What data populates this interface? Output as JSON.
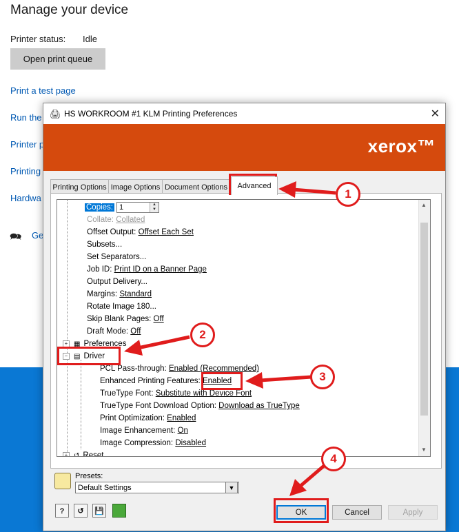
{
  "settings": {
    "title": "Manage your device",
    "printer_status_label": "Printer status:",
    "printer_status_value": "Idle",
    "open_queue_button": "Open print queue",
    "links": [
      "Print a test page",
      "Run the",
      "Printer p",
      "Printing",
      "Hardwa",
      "Ge"
    ]
  },
  "dialog": {
    "title": "HS WORKROOM #1 KLM Printing Preferences",
    "brand": "xerox™",
    "tabs": [
      "Printing Options",
      "Image Options",
      "Document Options",
      "Advanced"
    ],
    "active_tab": "Advanced"
  },
  "tree": {
    "copies_label": "Copies:",
    "copies_value": "1",
    "collate_label": "Collate:",
    "collate_value": "Collated",
    "offset_label": "Offset Output:",
    "offset_value": "Offset Each Set",
    "subsets": "Subsets...",
    "set_separators": "Set Separators...",
    "jobid_label": "Job ID:",
    "jobid_value": "Print ID on a Banner Page",
    "output_delivery": "Output Delivery...",
    "margins_label": "Margins:",
    "margins_value": "Standard",
    "rotate": "Rotate Image 180...",
    "skip_label": "Skip Blank Pages:",
    "skip_value": "Off",
    "draft_label": "Draft Mode:",
    "draft_value": "Off",
    "preferences": "Preferences",
    "driver": "Driver",
    "pcl_label": "PCL Pass-through:",
    "pcl_value": "Enabled (Recommended)",
    "epf_label": "Enhanced Printing Features:",
    "epf_value": "Enabled",
    "ttf_label": "TrueType Font:",
    "ttf_value": "Substitute with Device Font",
    "ttfd_label": "TrueType Font Download Option:",
    "ttfd_value": "Download as TrueType",
    "opt_label": "Print Optimization:",
    "opt_value": "Enabled",
    "enh_label": "Image Enhancement:",
    "enh_value": "On",
    "comp_label": "Image Compression:",
    "comp_value": "Disabled",
    "reset": "Reset"
  },
  "presets": {
    "label": "Presets:",
    "value": "Default Settings"
  },
  "footer": {
    "help": "?",
    "ok": "OK",
    "cancel": "Cancel",
    "apply": "Apply"
  },
  "annotations": [
    "1",
    "2",
    "3",
    "4"
  ],
  "colors": {
    "banner": "#d54a0d",
    "annotation": "#e01c1c",
    "selection": "#0078d7",
    "desktop": "#0a78d4"
  }
}
